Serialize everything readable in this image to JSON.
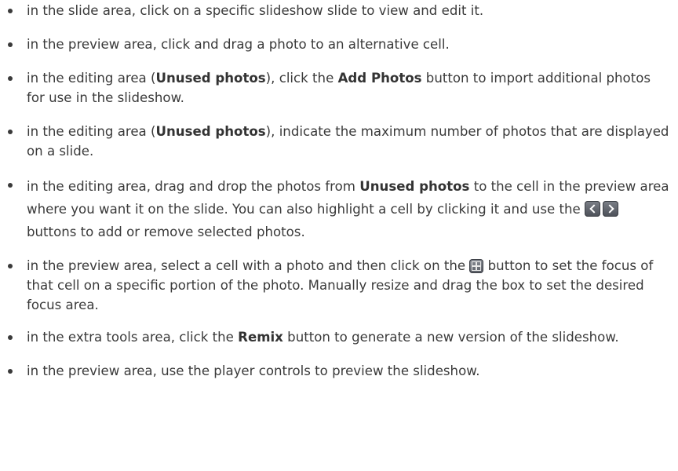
{
  "bullets": [
    {
      "pre": "in the slide area, click on a specific slideshow slide to view and edit it."
    },
    {
      "pre": "in the preview area, click and drag a photo to an alternative cell."
    },
    {
      "pre": "in the editing area (",
      "b1": "Unused photos",
      "mid": "), click the ",
      "b2": "Add Photos",
      "post": " button to import additional photos for use in the slideshow."
    },
    {
      "pre": "in the editing area (",
      "b1": "Unused photos",
      "post": "), indicate the maximum number of photos that are displayed on a slide."
    },
    {
      "pre": "in the editing area, drag and drop the photos from ",
      "b1": "Unused photos",
      "mid": " to the cell in the preview area where you want it on the slide. You can also highlight a cell by clicking it and use the ",
      "post": " buttons to add or remove selected photos."
    },
    {
      "pre": "in the preview area, select a cell with a photo and then click on the ",
      "post": " button to set the focus of that cell on a specific portion of the photo. Manually resize and drag the box to set the desired focus area."
    },
    {
      "pre": "in the extra tools area, click the ",
      "b1": "Remix",
      "post": " button to generate a new version of the slideshow."
    },
    {
      "pre": "in the preview area, use the player controls to preview the slideshow."
    }
  ],
  "icons": {
    "prev": "chevron-left-icon",
    "next": "chevron-right-icon",
    "focus": "focus-grid-icon"
  }
}
